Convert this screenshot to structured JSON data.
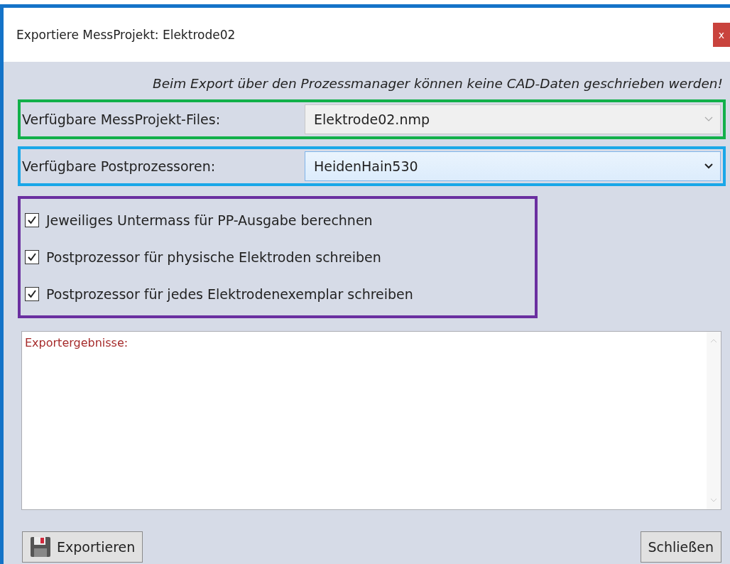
{
  "window": {
    "title": "Exportiere MessProjekt: Elektrode02",
    "close": "x"
  },
  "notice": "Beim Export über den Prozessmanager können keine CAD-Daten geschrieben werden!",
  "selectors": [
    {
      "label": "Verfügbare MessProjekt-Files:",
      "value": "Elektrode02.nmp",
      "focused": false,
      "color": "#12b04a"
    },
    {
      "label": "Verfügbare Postprozessoren:",
      "value": "HeidenHain530",
      "focused": true,
      "color": "#1aa7e8"
    }
  ],
  "groups": [
    {
      "color": "#6a2fa0",
      "options": [
        {
          "label": "Jeweiliges Untermass für PP-Ausgabe berechnen",
          "checked": true
        },
        {
          "label": "Postprozessor für physische Elektroden schreiben",
          "checked": true
        },
        {
          "label": "Postprozessor für jedes Elektrodenexemplar schreiben",
          "checked": true
        }
      ]
    }
  ],
  "results": {
    "label": "Exportergebnisse:"
  },
  "buttons": [
    {
      "label": "Exportieren",
      "kind": "export"
    },
    {
      "label": "Schließen",
      "kind": "close"
    }
  ]
}
